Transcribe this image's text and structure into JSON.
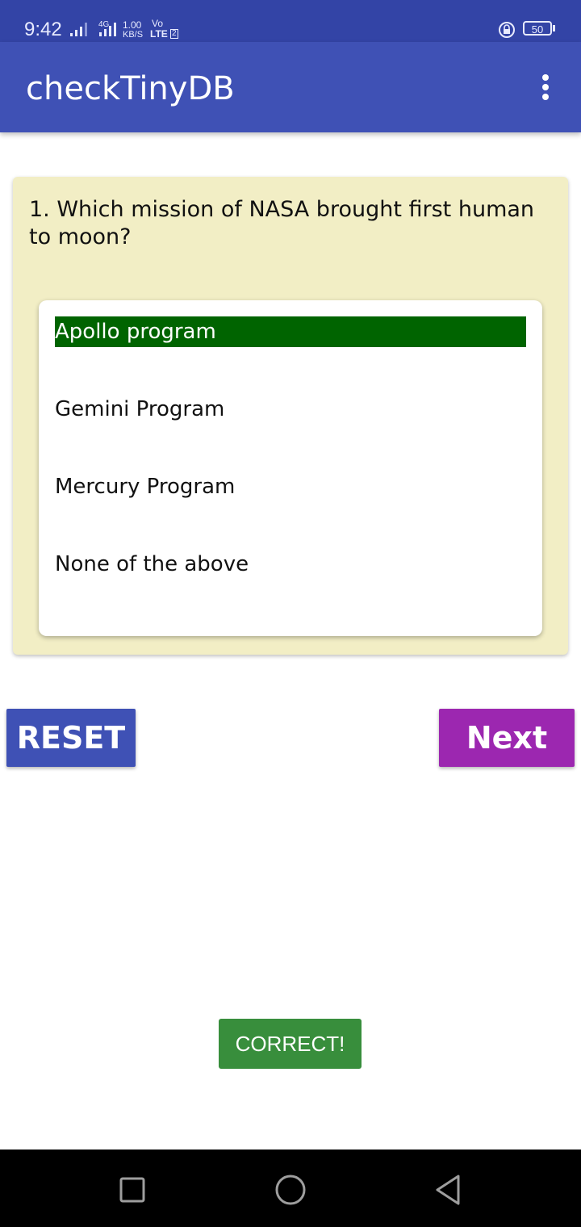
{
  "status_bar": {
    "time": "9:42",
    "network_4g": "4G",
    "speed_value": "1.00",
    "speed_unit": "KB/S",
    "volte_top": "Vo",
    "volte_bottom": "LTE",
    "sim_slot": "2",
    "battery": "50",
    "icons": [
      "signal-icon",
      "signal-4g-icon",
      "rotation-lock-icon",
      "battery-icon"
    ]
  },
  "appbar": {
    "title": "checkTinyDB",
    "menu_icon": "more-vert-icon"
  },
  "quiz": {
    "question": "1. Which mission of NASA brought first human to moon?",
    "options": [
      {
        "label": "Apollo program",
        "selected": true
      },
      {
        "label": "Gemini Program",
        "selected": false
      },
      {
        "label": "Mercury Program",
        "selected": false
      },
      {
        "label": "None of the above",
        "selected": false
      }
    ],
    "selected_color": "#006400"
  },
  "buttons": {
    "reset_label": "RESET",
    "next_label": "Next >>"
  },
  "toast": {
    "text": "CORRECT!"
  },
  "nav_bar": {
    "icons": [
      "recents-icon",
      "home-icon",
      "back-icon"
    ]
  },
  "colors": {
    "status_bar": "#3344a6",
    "app_bar": "#3f51b5",
    "card": "#f2eec5",
    "reset": "#3f51b5",
    "next": "#9c27b0",
    "toast": "#388e3c"
  }
}
